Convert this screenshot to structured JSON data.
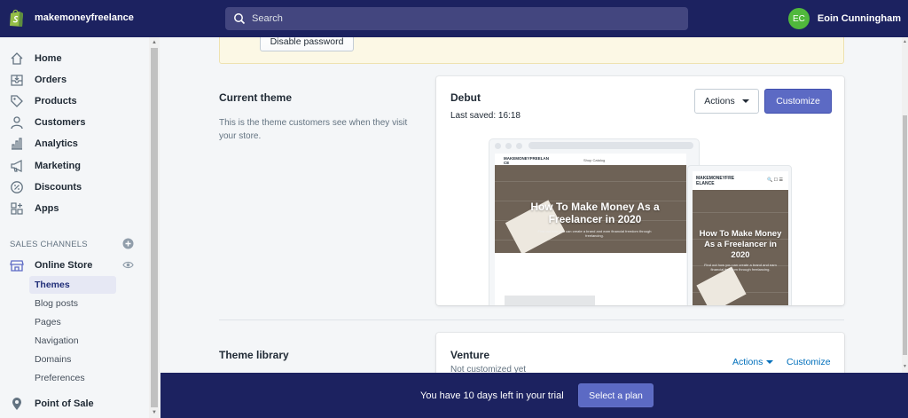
{
  "topbar": {
    "store_name": "makemoneyfreelance",
    "search_placeholder": "Search",
    "user_initials": "EC",
    "user_name": "Eoin Cunningham"
  },
  "sidebar": {
    "items": [
      {
        "label": "Home",
        "icon": "home-icon"
      },
      {
        "label": "Orders",
        "icon": "orders-icon"
      },
      {
        "label": "Products",
        "icon": "tag-icon"
      },
      {
        "label": "Customers",
        "icon": "customers-icon"
      },
      {
        "label": "Analytics",
        "icon": "analytics-icon"
      },
      {
        "label": "Marketing",
        "icon": "megaphone-icon"
      },
      {
        "label": "Discounts",
        "icon": "discount-icon"
      },
      {
        "label": "Apps",
        "icon": "apps-icon"
      }
    ],
    "sales_channels_title": "SALES CHANNELS",
    "online_store_label": "Online Store",
    "sub_items": [
      "Themes",
      "Blog posts",
      "Pages",
      "Navigation",
      "Domains",
      "Preferences"
    ],
    "active_sub_item": "Themes",
    "point_of_sale_label": "Point of Sale"
  },
  "banner": {
    "disable_password_label": "Disable password"
  },
  "current_theme": {
    "section_title": "Current theme",
    "section_description": "This is the theme customers see when they visit your store.",
    "theme_name": "Debut",
    "last_saved": "Last saved: 16:18",
    "actions_label": "Actions",
    "customize_label": "Customize",
    "preview": {
      "desktop_store_name": "MAKEMONEYFREELAN CE",
      "desktop_nav": "Shop   Catalog",
      "mobile_store_name": "MAKEMONEYFRE ELANCE",
      "hero_title": "How To Make Money As a Freelancer in 2020",
      "hero_subtitle": "Find out how you can create a brand and earn financial freedom through freelancing."
    }
  },
  "theme_library": {
    "section_title": "Theme library",
    "theme_name": "Venture",
    "status": "Not customized yet",
    "actions_label": "Actions",
    "customize_label": "Customize"
  },
  "trial_bar": {
    "text": "You have 10 days left in your trial",
    "button_label": "Select a plan"
  },
  "colors": {
    "topbar_bg": "#1c2260",
    "primary_button": "#5c6ac4",
    "link": "#006fbb",
    "avatar": "#50b83c",
    "banner_bg": "#fcf8e5"
  }
}
